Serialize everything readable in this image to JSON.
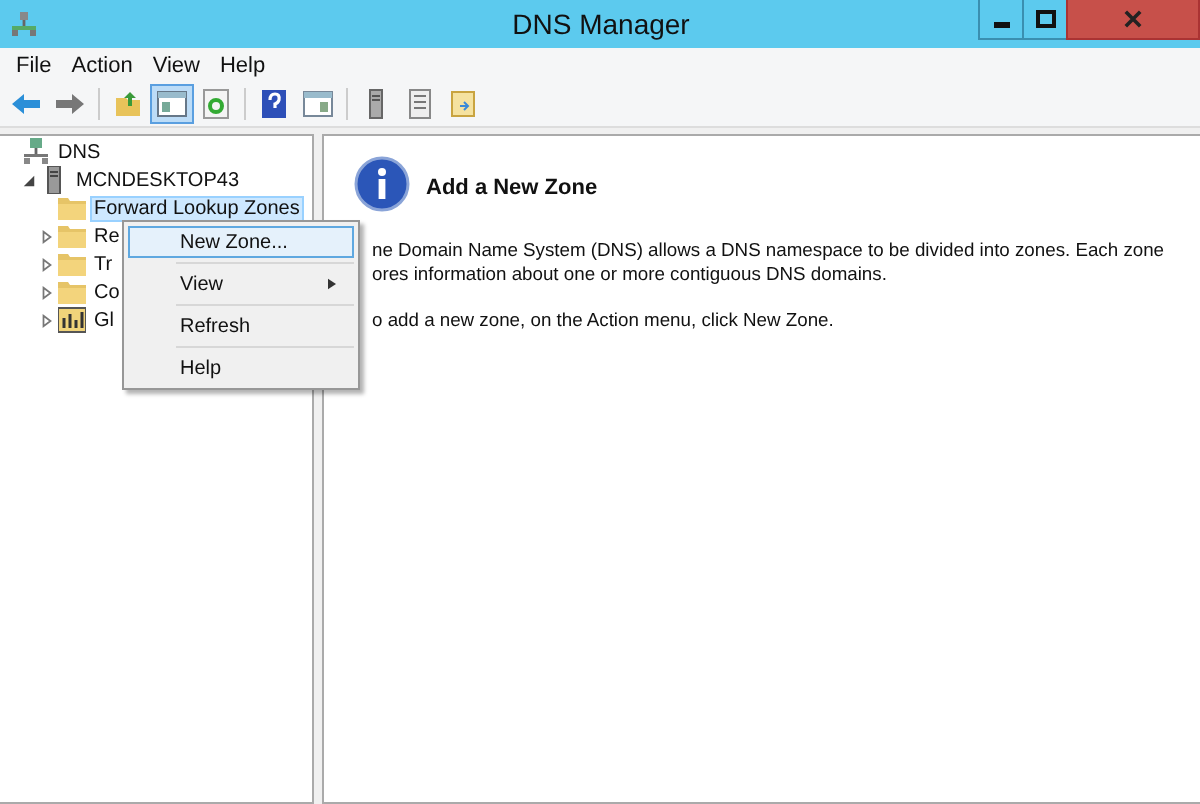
{
  "window": {
    "title": "DNS Manager"
  },
  "menu_bar": [
    "File",
    "Action",
    "View",
    "Help"
  ],
  "toolbar": [
    {
      "kind": "back",
      "pressed": false
    },
    {
      "kind": "forward",
      "pressed": false
    },
    {
      "kind": "separator"
    },
    {
      "kind": "folder-up",
      "pressed": false
    },
    {
      "kind": "tree-pane",
      "pressed": true
    },
    {
      "kind": "refresh",
      "pressed": false
    },
    {
      "kind": "separator"
    },
    {
      "kind": "help",
      "pressed": false
    },
    {
      "kind": "pane",
      "pressed": false
    },
    {
      "kind": "separator"
    },
    {
      "kind": "server",
      "pressed": false
    },
    {
      "kind": "list",
      "pressed": false
    },
    {
      "kind": "export",
      "pressed": false
    }
  ],
  "tree": [
    {
      "label": "DNS",
      "kind": "root",
      "selected": false,
      "children": [
        {
          "label": "MCNDESKTOP43",
          "kind": "server",
          "expanded": true,
          "selected": false,
          "children": [
            {
              "label": "Forward Lookup Zones",
              "kind": "folder",
              "selected": true
            },
            {
              "label": "Re",
              "kind": "folder",
              "expanded": false,
              "selected": false
            },
            {
              "label": "Tr",
              "kind": "folder",
              "expanded": false,
              "selected": false
            },
            {
              "label": "Co",
              "kind": "folder",
              "expanded": false,
              "selected": false
            },
            {
              "label": "Gl",
              "kind": "log",
              "expanded": false,
              "selected": false
            }
          ]
        }
      ]
    }
  ],
  "context_menu": [
    {
      "label": "New Zone...",
      "selected": true,
      "submenu": false
    },
    {
      "label": "View",
      "selected": false,
      "submenu": true
    },
    {
      "label": "Refresh",
      "selected": false,
      "submenu": false
    },
    {
      "label": "Help",
      "selected": false,
      "submenu": false
    }
  ],
  "details": {
    "title": "Add a New Zone",
    "description_lines": [
      "ne Domain Name System (DNS) allows a DNS namespace to be divided into zones. Each zone",
      "ores information about one or more contiguous DNS domains."
    ],
    "instruction": "o add a new zone, on the Action menu, click New Zone."
  }
}
